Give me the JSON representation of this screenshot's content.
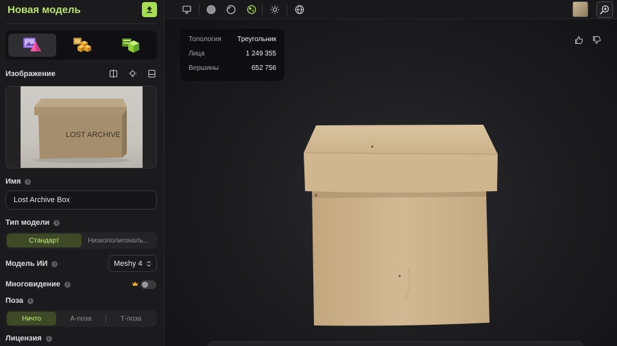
{
  "sidebar": {
    "title": "Новая модель",
    "modes": [
      {
        "icon": "image-to-3d-icon",
        "active": true
      },
      {
        "icon": "multi-cubes-icon",
        "active": false
      },
      {
        "icon": "text-to-3d-icon",
        "active": false
      }
    ],
    "image_section": {
      "label": "Изображение",
      "thumbnail_text": "LOST ARCHIVE"
    },
    "name": {
      "label": "Имя",
      "value": "Lost Archive Box"
    },
    "model_type": {
      "label": "Тип модели",
      "options": [
        "Стандарт",
        "Низкополигональ..."
      ],
      "selected": "Стандарт"
    },
    "ai_model": {
      "label": "Модель ИИ",
      "value": "Meshy 4"
    },
    "multiview": {
      "label": "Многовидение",
      "enabled": false
    },
    "pose": {
      "label": "Поза",
      "options": [
        "Ничто",
        "А-поза",
        "Т-поза"
      ],
      "selected": "Ничто"
    },
    "license": {
      "label": "Лицензия"
    }
  },
  "viewport": {
    "stats": {
      "topology_label": "Топология",
      "topology_value": "Треугольник",
      "faces_label": "Лица",
      "faces_value": "1 249 355",
      "vertices_label": "Вершины",
      "vertices_value": "652 756"
    }
  },
  "colors": {
    "accent": "#b6e36a",
    "accent_button": "#a8df52",
    "box": "#cdb58e"
  }
}
